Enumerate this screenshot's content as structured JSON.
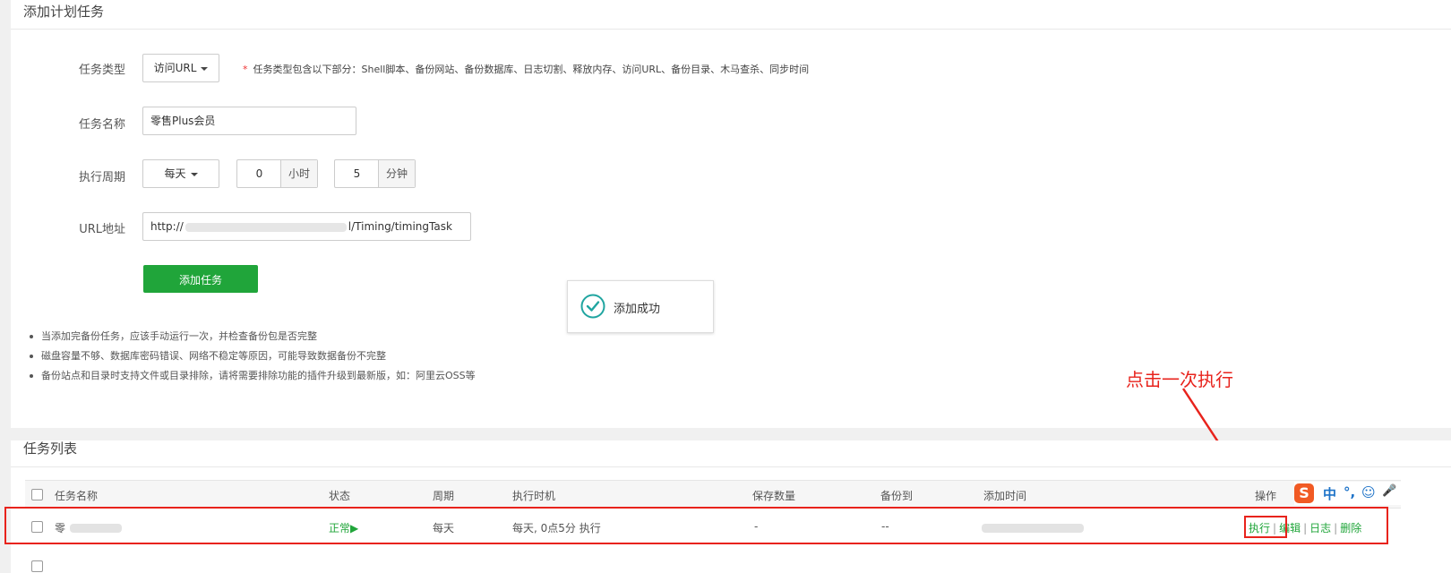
{
  "add_panel": {
    "title": "添加计划任务",
    "task_type": {
      "label": "任务类型",
      "value": "访问URL",
      "hint_star": "*",
      "hint": "任务类型包含以下部分：Shell脚本、备份网站、备份数据库、日志切割、释放内存、访问URL、备份目录、木马查杀、同步时间"
    },
    "task_name": {
      "label": "任务名称",
      "value": "零售Plus会员"
    },
    "period": {
      "label": "执行周期",
      "frequency": "每天",
      "hour": "0",
      "hour_unit": "小时",
      "minute": "5",
      "minute_unit": "分钟"
    },
    "url": {
      "label": "URL地址",
      "value_prefix": "http://",
      "value_suffix": "l/Timing/timingTask"
    },
    "submit_label": "添加任务",
    "notes": [
      "当添加完备份任务，应该手动运行一次，并检查备份包是否完整",
      "磁盘容量不够、数据库密码错误、网络不稳定等原因，可能导致数据备份不完整",
      "备份站点和目录时支持文件或目录排除，请将需要排除功能的插件升级到最新版，如：阿里云OSS等"
    ]
  },
  "toast": {
    "text": "添加成功",
    "color": "#20a5a0"
  },
  "annotation": {
    "text": "点击一次执行",
    "color": "#e8231c"
  },
  "list_panel": {
    "title": "任务列表",
    "columns": [
      "任务名称",
      "状态",
      "周期",
      "执行时机",
      "保存数量",
      "备份到",
      "添加时间",
      "操作"
    ],
    "rows": [
      {
        "name_visible": "零",
        "status": "正常",
        "status_icon": "play-triangle-icon",
        "period": "每天",
        "timing": "每天, 0点5分 执行",
        "save_count": "-",
        "backup_to": "--",
        "actions": [
          "执行",
          "编辑",
          "日志",
          "删除"
        ]
      }
    ]
  },
  "ime_toolbar": {
    "chars": [
      "中",
      "°,",
      "☺",
      "🎤"
    ]
  }
}
